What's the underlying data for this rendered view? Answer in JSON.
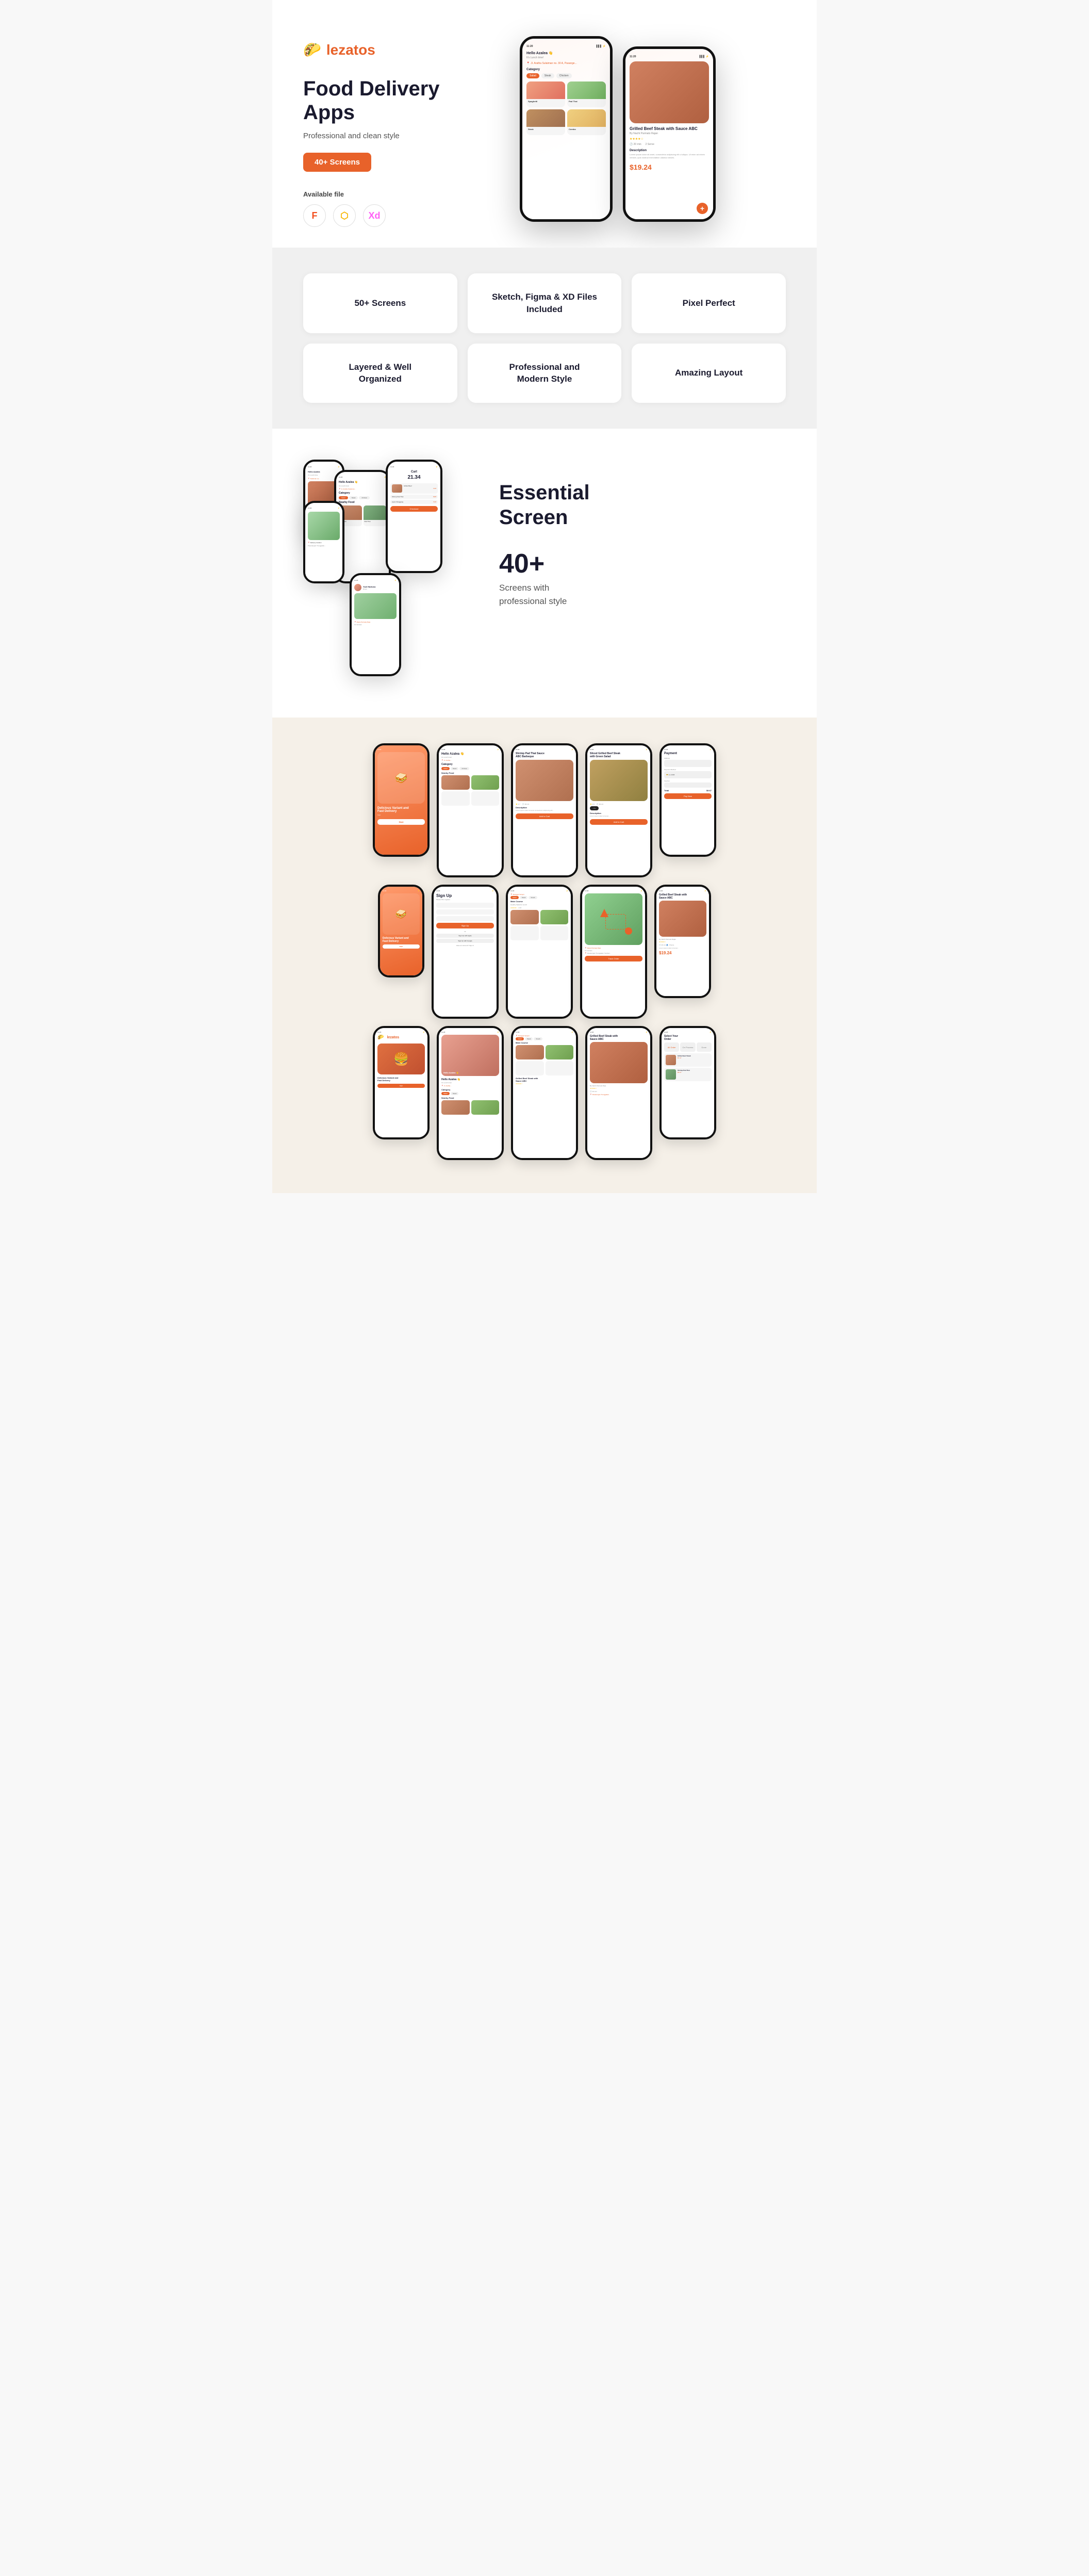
{
  "brand": {
    "name": "lezatos",
    "logo_icon": "🌮",
    "tagline": "Food Delivery Apps",
    "subtitle": "Professional and clean style",
    "badge": "40+ Screens",
    "available_file_label": "Available file",
    "file_types": [
      "F",
      "S",
      "Xd"
    ]
  },
  "features": [
    {
      "id": "screens",
      "text": "50+\nScreens"
    },
    {
      "id": "files",
      "text": "Sketch, Figma &\nXD Files Included"
    },
    {
      "id": "pixel",
      "text": "Pixel Perfect"
    },
    {
      "id": "layered",
      "text": "Layered & Well\nOrganized"
    },
    {
      "id": "modern",
      "text": "Professional and\nModern Style"
    },
    {
      "id": "layout",
      "text": "Amazing Layout"
    }
  ],
  "essential": {
    "title": "Essential\nScreen",
    "count": "40+",
    "description": "Screens with\nprofessional style"
  },
  "phone_content": {
    "greeting": "Hello Azalea 👋",
    "lunch": "It's Lunch time!",
    "location": "Jl. Aratha Sulaiman no. 30 A, Pasange...",
    "category_label": "Category",
    "categories": [
      "Salad",
      "Steak",
      "Chicken"
    ],
    "nearby_label": "Nearby Food",
    "food_items": [
      {
        "name": "Spaghetti with Spicy Mixed Seafood",
        "price": "8.47"
      },
      {
        "name": "Delicious Pad Thai Spicy Seafood",
        "price": "9.67"
      }
    ],
    "detail_title": "Grilled Beef Steak with\nSauce ABC",
    "detail_author": "By Nacht Parmato Rajan",
    "detail_price": "$19.24",
    "detail_desc": "Lorem ipsum dolor sit amet, consectetur adipiscing elit ut aliqua. Ut enim ad minim veniam, quis nostrud exercitation ullamco laboris."
  },
  "cart": {
    "title": "Cart",
    "total": "21.34",
    "items": [
      {
        "name": "Grilled Beef Steak with Sauce ABC",
        "qty": "1",
        "price": "7.47"
      },
      {
        "name": "Shrimp Pad Thai Sauce",
        "price": "5.67"
      },
      {
        "name": "Ayam Panggang Combo",
        "price": "7.47"
      }
    ],
    "checkout_label": "Checkout"
  },
  "signup": {
    "title": "Sign Up",
    "subtitle": "Please fill to register",
    "name_placeholder": "Azalea",
    "email_placeholder": "Type your email",
    "password_placeholder": "Type your password",
    "button": "Sign Up",
    "or_text": "Or",
    "apple_btn": "Sign Up with Apple",
    "google_btn": "Sign Up with Google",
    "login_text": "Have an account? Sign In"
  },
  "food_screens": [
    {
      "name": "Shrimp Pad Thai Sauce ABC Barbeque",
      "price": "9.67",
      "rating": "4.7",
      "time": "30 min"
    },
    {
      "name": "Sliced Grilled Beef Steak with Green Salad",
      "price": "9.67",
      "rating": "4.5",
      "time": "30 min"
    }
  ],
  "onboarding": {
    "title": "Delicious Variant and\nFast Delivery",
    "btn": "Start"
  },
  "payment": {
    "title": "Payment",
    "address_label": "Address",
    "method_label": "Payment Method",
    "voucher_label": "Voucher",
    "total_label": "Total",
    "amount": "9.67"
  }
}
